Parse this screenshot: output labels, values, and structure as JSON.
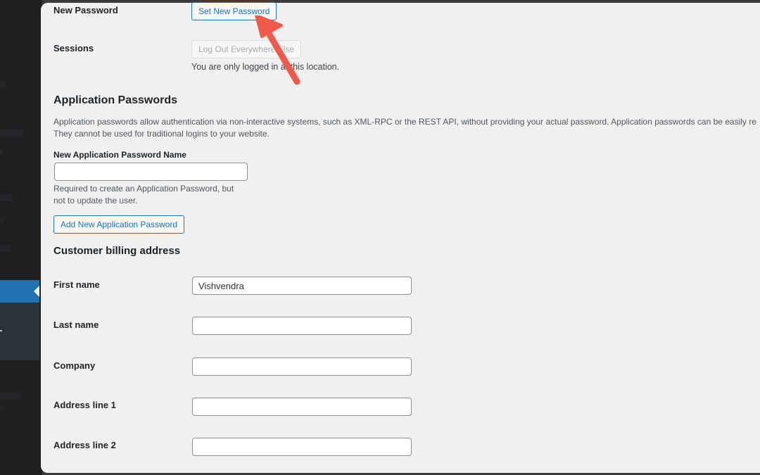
{
  "account": {
    "new_password_label": "New Password",
    "set_new_password_button": "Set New Password",
    "sessions_label": "Sessions",
    "logout_everywhere_button": "Log Out Everywhere Else",
    "sessions_note": "You are only logged in at this location."
  },
  "app_passwords": {
    "title": "Application Passwords",
    "description_line1": "Application passwords allow authentication via non-interactive systems, such as XML-RPC or the REST API, without providing your actual password. Application passwords can be easily re",
    "description_line2": "They cannot be used for traditional logins to your website.",
    "name_label": "New Application Password Name",
    "name_value": "",
    "help_line1": "Required to create an Application Password, but",
    "help_line2": "not to update the user.",
    "add_button": "Add New Application Password"
  },
  "billing": {
    "title": "Customer billing address",
    "fields": [
      {
        "label": "First name",
        "value": "Vishvendra"
      },
      {
        "label": "Last name",
        "value": ""
      },
      {
        "label": "Company",
        "value": ""
      },
      {
        "label": "Address line 1",
        "value": ""
      },
      {
        "label": "Address line 2",
        "value": ""
      }
    ]
  },
  "annotation": {
    "arrow_color": "#f05a4a",
    "arrow_icon": "red-callout-arrow"
  },
  "colors": {
    "accent": "#2271b1",
    "panel_bg": "#f0f0f1",
    "sidebar_bg": "#1e1f21"
  }
}
